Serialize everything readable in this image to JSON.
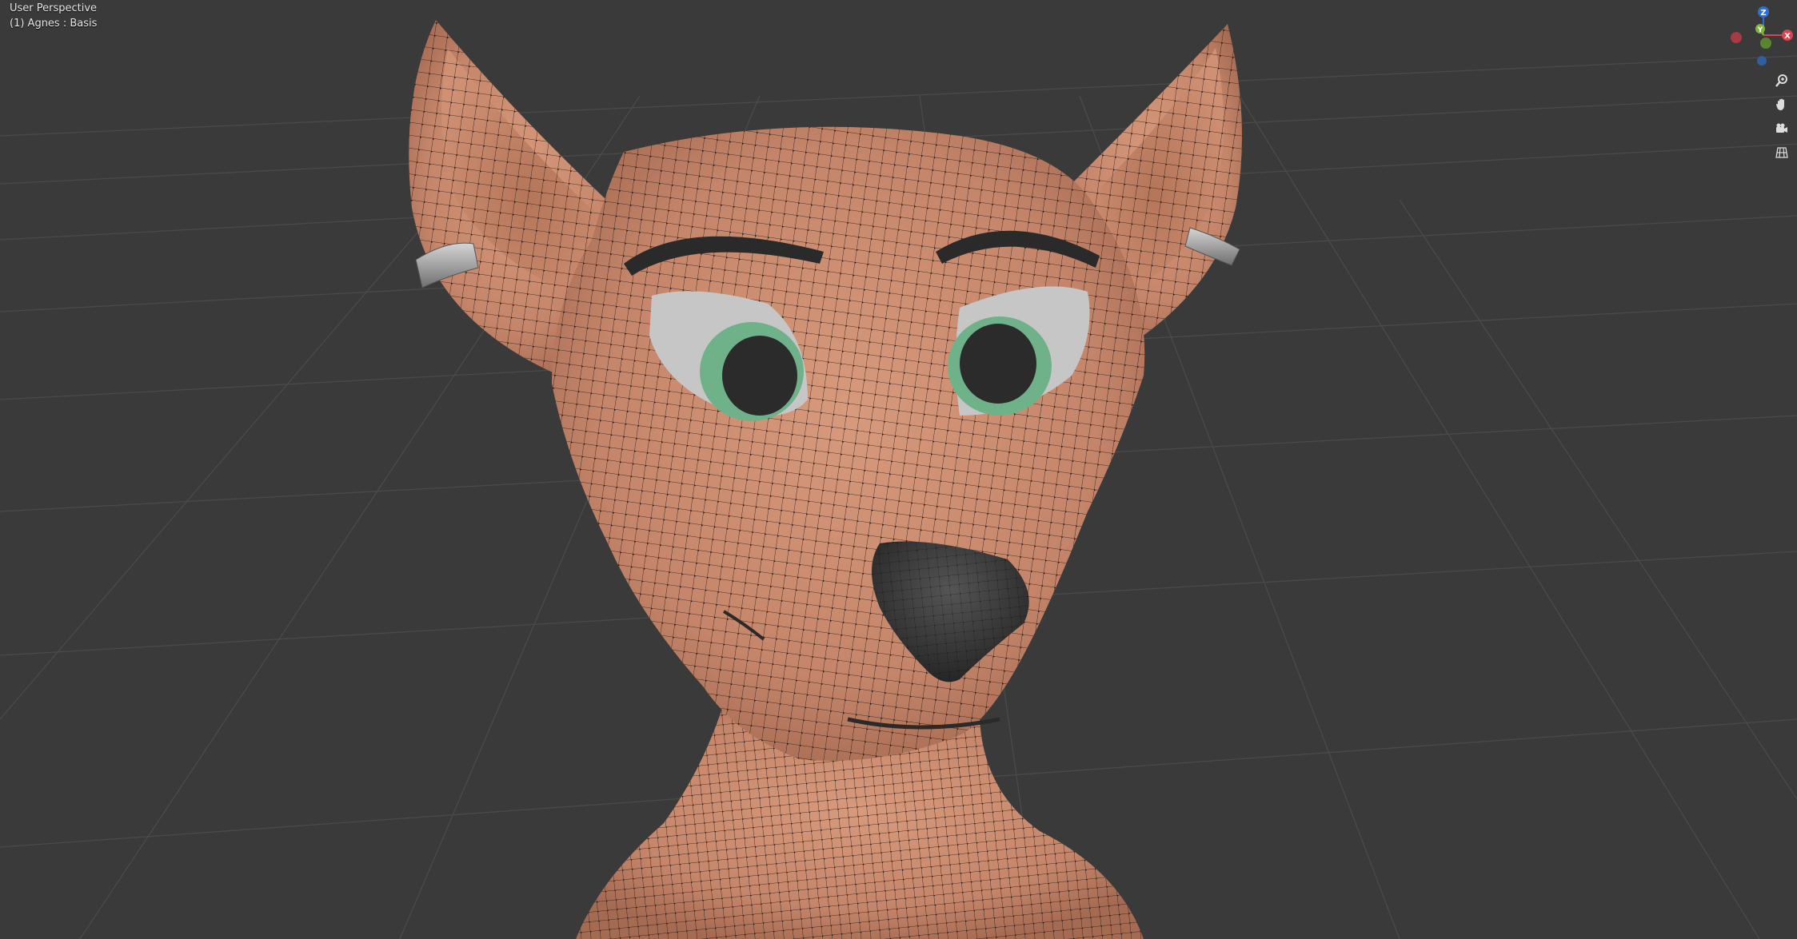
{
  "viewport": {
    "view_name": "User Perspective",
    "object_info": "(1) Agnes : Basis"
  },
  "gizmo": {
    "z_label": "Z",
    "y_label": "Y",
    "x_label": "X",
    "z_color": "#2d6fd6",
    "y_color": "#7fb53a",
    "x_color": "#d9434f",
    "neg_x_color": "#a83a44",
    "neg_z_color": "#2f5f9e"
  },
  "nav_buttons": [
    {
      "icon": "zoom-icon"
    },
    {
      "icon": "hand-pan-icon"
    },
    {
      "icon": "camera-icon"
    },
    {
      "icon": "grid-view-icon"
    }
  ],
  "colors": {
    "background": "#3a3a3a",
    "grid_line": "#4a4a4a",
    "skin": "#c9876a",
    "wire": "#1a1a1a",
    "iris": "#6fb28a",
    "pupil": "#2b2b2b",
    "sclera": "#c6c6c6",
    "nose": "#2f2f2f",
    "ring": "#a9a9a9"
  }
}
